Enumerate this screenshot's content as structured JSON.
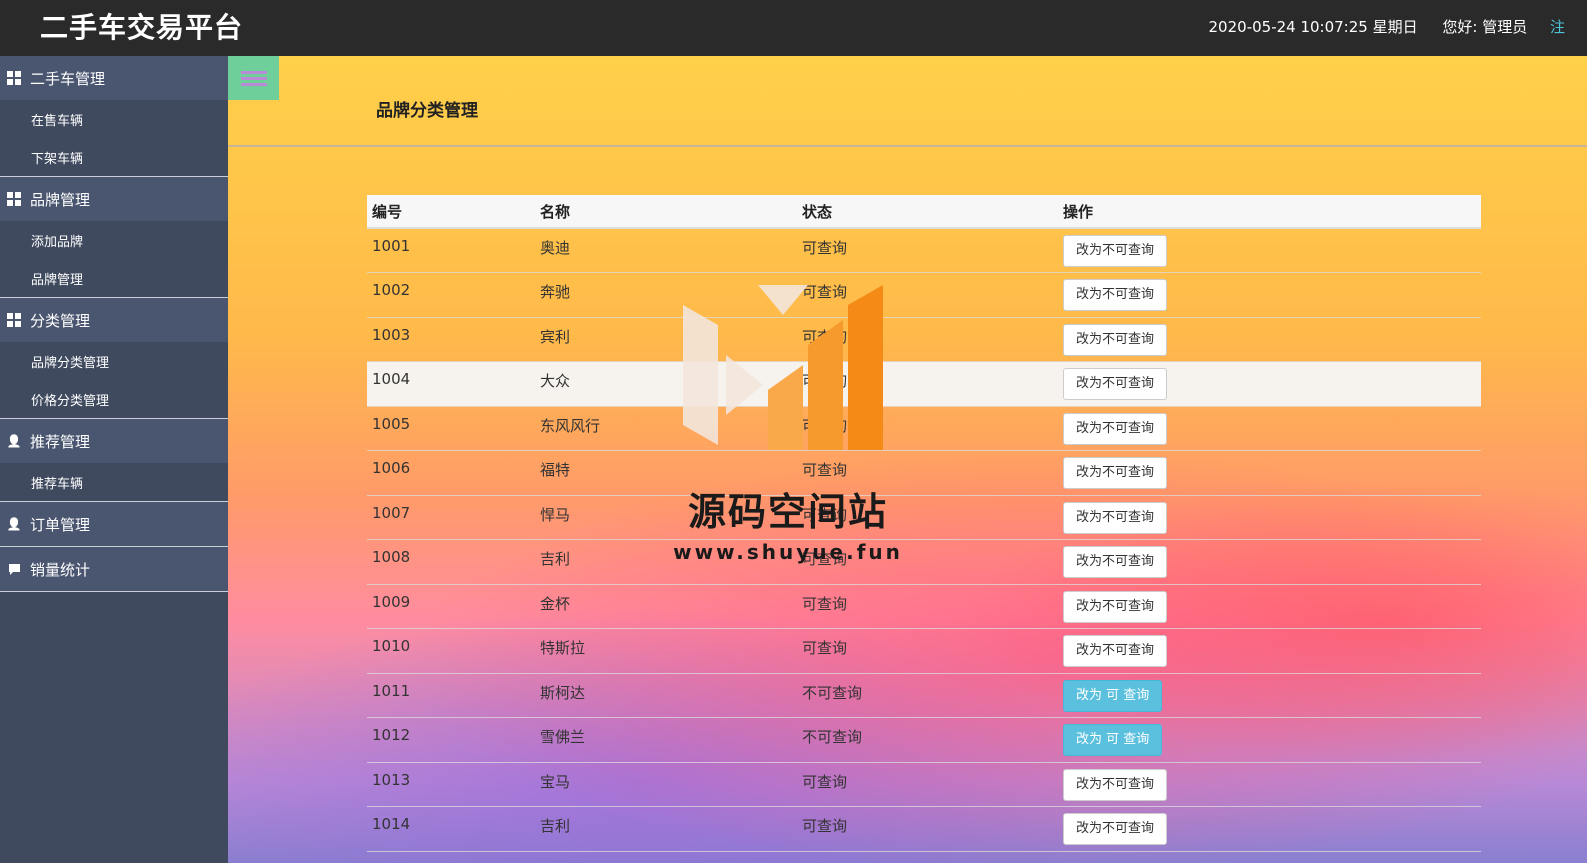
{
  "header": {
    "app_title": "二手车交易平台",
    "datetime": "2020-05-24 10:07:25 星期日",
    "greeting": "您好: 管理员"
  },
  "sidebar": {
    "groups": [
      {
        "label": "二手车管理",
        "icon": "grid-icon",
        "items": [
          {
            "label": "在售车辆"
          },
          {
            "label": "下架车辆"
          }
        ]
      },
      {
        "label": "品牌管理",
        "icon": "grid-icon",
        "items": [
          {
            "label": "添加品牌"
          },
          {
            "label": "品牌管理"
          }
        ]
      },
      {
        "label": "分类管理",
        "icon": "grid-icon",
        "items": [
          {
            "label": "品牌分类管理"
          },
          {
            "label": "价格分类管理"
          }
        ]
      },
      {
        "label": "推荐管理",
        "icon": "user-icon",
        "items": [
          {
            "label": "推荐车辆"
          }
        ]
      },
      {
        "label": "订单管理",
        "icon": "user-icon",
        "items": []
      },
      {
        "label": "销量统计",
        "icon": "comment-icon",
        "items": []
      }
    ]
  },
  "main": {
    "page_title": "品牌分类管理",
    "table": {
      "headers": [
        "编号",
        "名称",
        "状态",
        "操作"
      ],
      "rows": [
        {
          "id": "1001",
          "name": "奥迪",
          "state": "可查询",
          "action": "改为不可查询",
          "style": "default"
        },
        {
          "id": "1002",
          "name": "奔驰",
          "state": "可查询",
          "action": "改为不可查询",
          "style": "default"
        },
        {
          "id": "1003",
          "name": "宾利",
          "state": "可查询",
          "action": "改为不可查询",
          "style": "default"
        },
        {
          "id": "1004",
          "name": "大众",
          "state": "可查询",
          "action": "改为不可查询",
          "style": "default"
        },
        {
          "id": "1005",
          "name": "东风风行",
          "state": "可查询",
          "action": "改为不可查询",
          "style": "default"
        },
        {
          "id": "1006",
          "name": "福特",
          "state": "可查询",
          "action": "改为不可查询",
          "style": "default"
        },
        {
          "id": "1007",
          "name": "悍马",
          "state": "可查询",
          "action": "改为不可查询",
          "style": "default"
        },
        {
          "id": "1008",
          "name": "吉利",
          "state": "可查询",
          "action": "改为不可查询",
          "style": "default"
        },
        {
          "id": "1009",
          "name": "金杯",
          "state": "可查询",
          "action": "改为不可查询",
          "style": "default"
        },
        {
          "id": "1010",
          "name": "特斯拉",
          "state": "可查询",
          "action": "改为不可查询",
          "style": "default"
        },
        {
          "id": "1011",
          "name": "斯柯达",
          "state": "不可查询",
          "action": "改为 可 查询",
          "style": "info"
        },
        {
          "id": "1012",
          "name": "雪佛兰",
          "state": "不可查询",
          "action": "改为 可 查询",
          "style": "info"
        },
        {
          "id": "1013",
          "name": "宝马",
          "state": "可查询",
          "action": "改为不可查询",
          "style": "default"
        },
        {
          "id": "1014",
          "name": "吉利",
          "state": "可查询",
          "action": "改为不可查询",
          "style": "default"
        }
      ]
    }
  },
  "watermark": {
    "text": "源码空间站",
    "url": "www.shuyue.fun"
  },
  "colors": {
    "topbar": "#2a2a2a",
    "sidebar": "#3f4a5f",
    "sidebar_head": "#4a5670",
    "info_button": "#5bc0de",
    "toggle": "#6fcf9a"
  }
}
